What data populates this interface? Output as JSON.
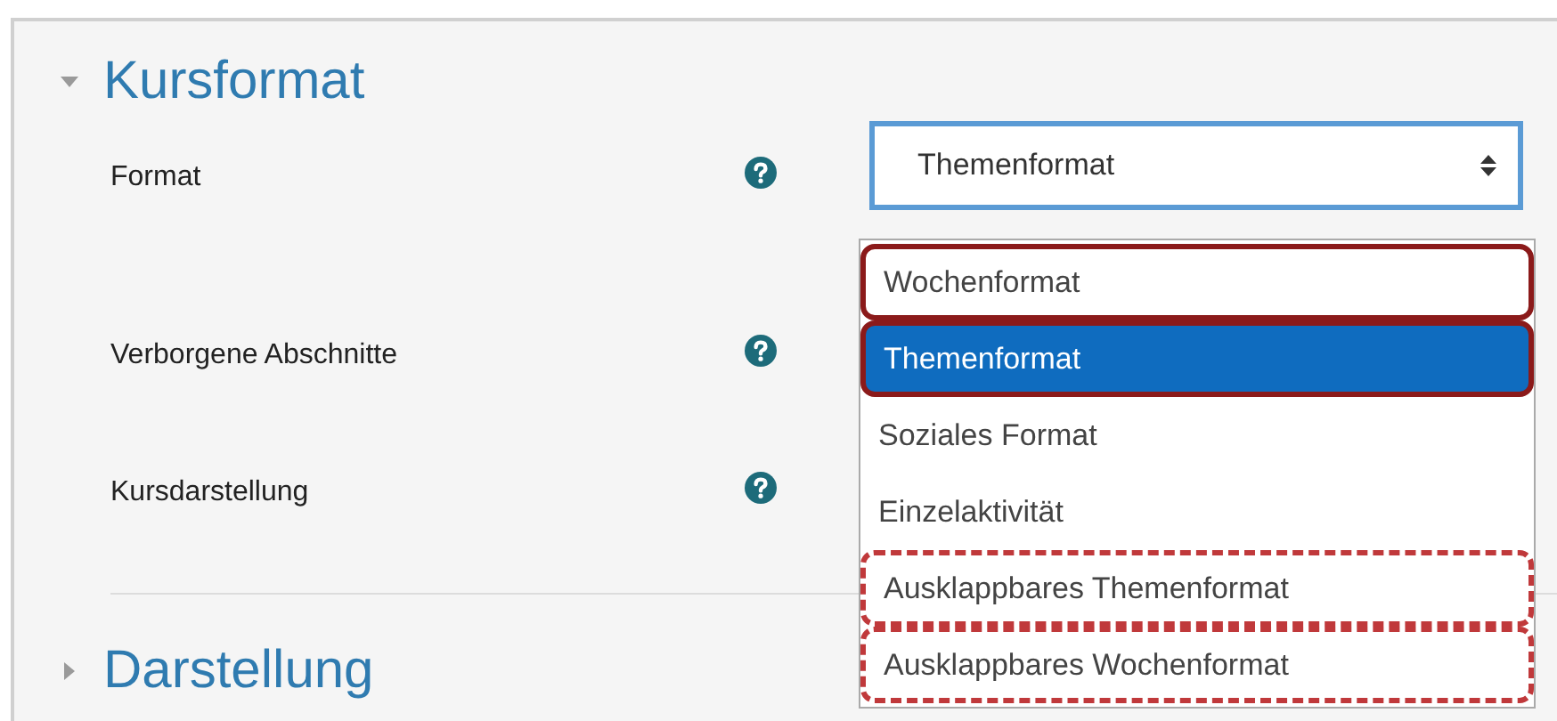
{
  "sections": [
    {
      "title": "Kursformat",
      "expanded": true
    },
    {
      "title": "Darstellung",
      "expanded": false
    }
  ],
  "fields": [
    {
      "label": "Format",
      "value": "Themenformat"
    },
    {
      "label": "Verborgene Abschnitte"
    },
    {
      "label": "Kursdarstellung"
    }
  ],
  "dropdown_options": [
    {
      "label": "Wochenformat",
      "selected": false,
      "outlined": true,
      "dashed": false
    },
    {
      "label": "Themenformat",
      "selected": true,
      "outlined": true,
      "dashed": false
    },
    {
      "label": "Soziales Format",
      "selected": false,
      "outlined": false
    },
    {
      "label": "Einzelaktivität",
      "selected": false,
      "outlined": false
    },
    {
      "label": "Ausklappbares Themenformat",
      "selected": false,
      "outlined": true,
      "dashed": true
    },
    {
      "label": "Ausklappbares Wochenformat",
      "selected": false,
      "outlined": true,
      "dashed": true
    }
  ]
}
